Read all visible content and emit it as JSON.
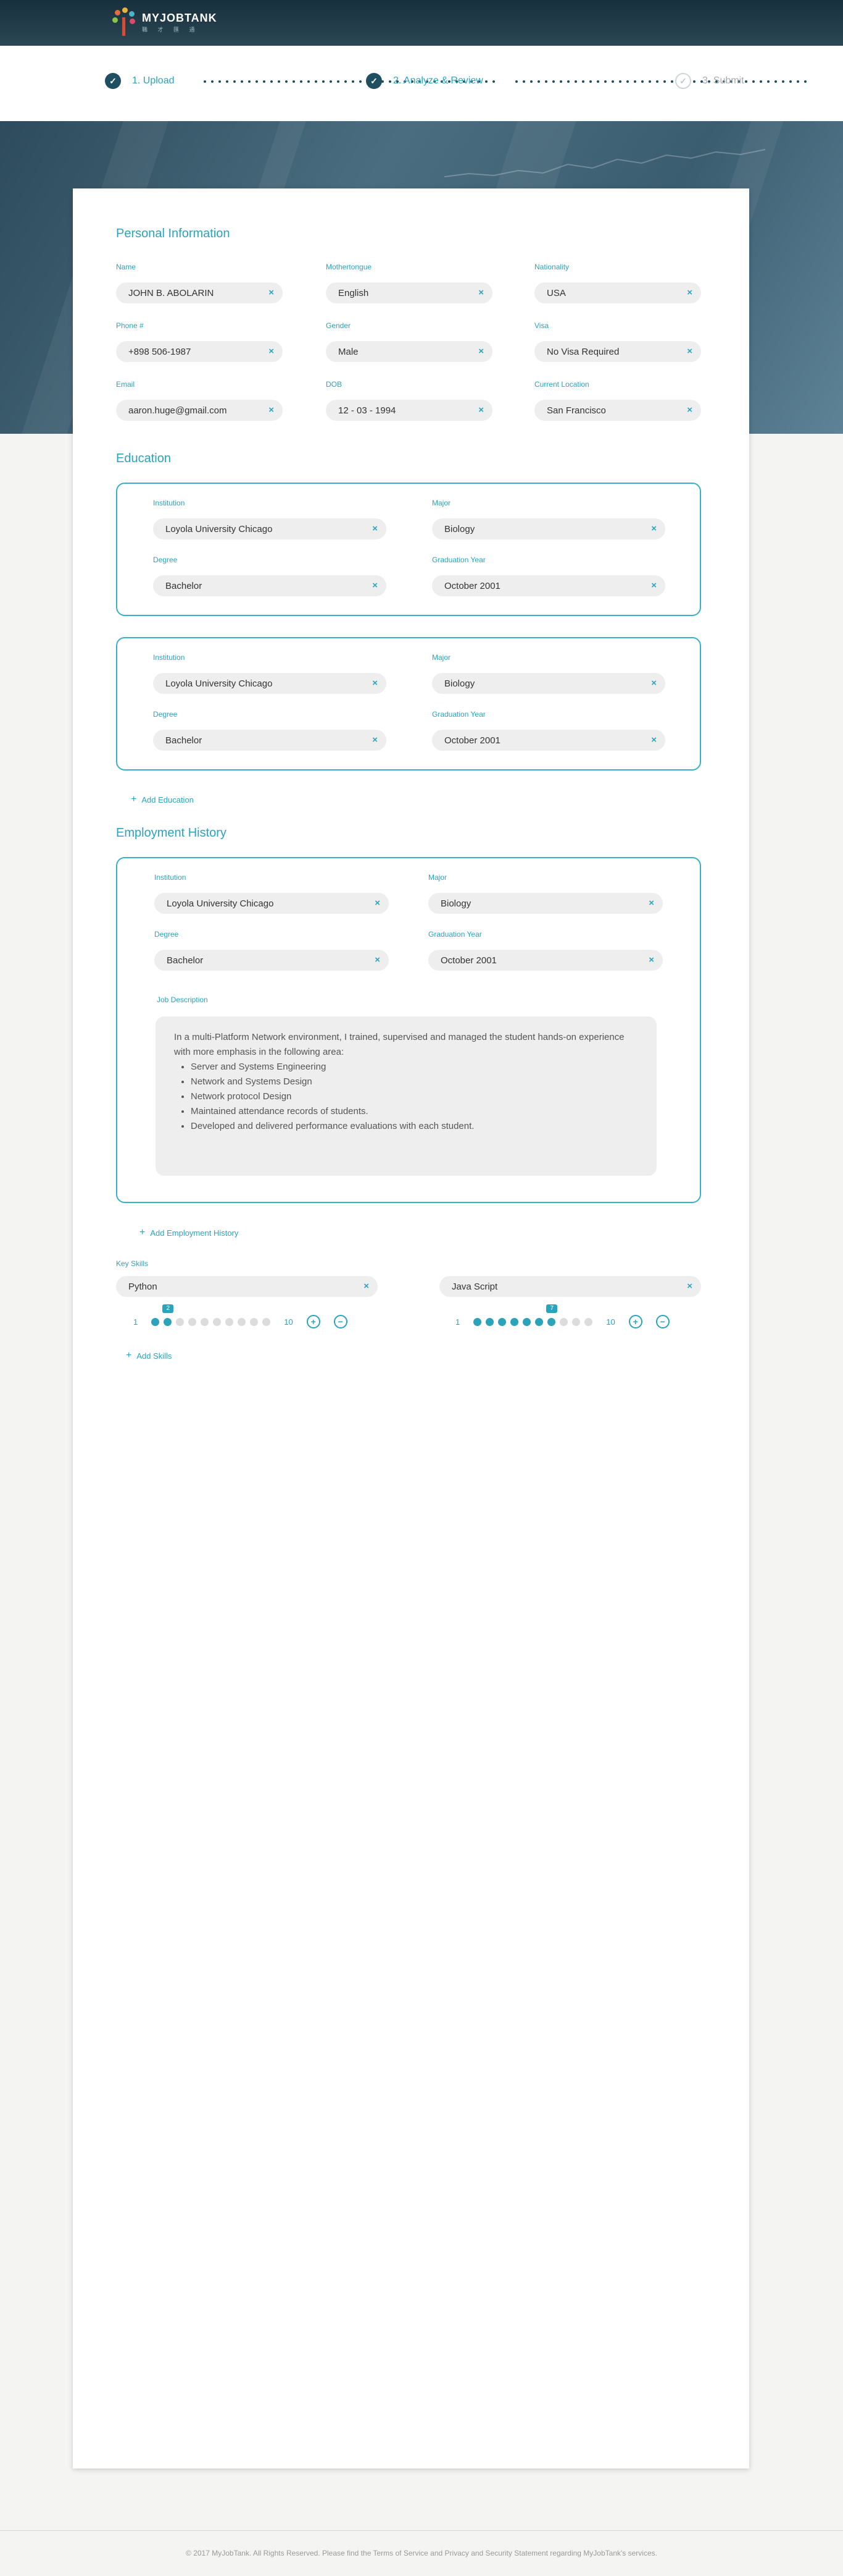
{
  "brand": {
    "name": "MYJOBTANK",
    "subtitle": "職 才 匯 通"
  },
  "steps": [
    {
      "label": "1. Upload",
      "state": "done",
      "mark": "✓"
    },
    {
      "label": "2. Analyze & Review",
      "state": "done",
      "mark": "✓"
    },
    {
      "label": "3. Submit",
      "state": "todo",
      "mark": "✓"
    }
  ],
  "personal": {
    "title": "Personal Information",
    "fields": [
      {
        "label": "Name",
        "value": "JOHN B. ABOLARIN"
      },
      {
        "label": "Mothertongue",
        "value": "English"
      },
      {
        "label": "Nationality",
        "value": "USA"
      },
      {
        "label": "Phone #",
        "value": "+898 506-1987"
      },
      {
        "label": "Gender",
        "value": "Male"
      },
      {
        "label": "Visa",
        "value": "No Visa Required"
      },
      {
        "label": "Email",
        "value": "aaron.huge@gmail.com"
      },
      {
        "label": "DOB",
        "value": "12 - 03 - 1994"
      },
      {
        "label": "Current Location",
        "value": "San Francisco"
      }
    ]
  },
  "education": {
    "title": "Education",
    "entries": [
      {
        "institution_label": "Institution",
        "institution": "Loyola University Chicago",
        "major_label": "Major",
        "major": "Biology",
        "degree_label": "Degree",
        "degree": "Bachelor",
        "grad_label": "Graduation Year",
        "grad": "October 2001"
      },
      {
        "institution_label": "Institution",
        "institution": "Loyola University Chicago",
        "major_label": "Major",
        "major": "Biology",
        "degree_label": "Degree",
        "degree": "Bachelor",
        "grad_label": "Graduation Year",
        "grad": "October 2001"
      }
    ],
    "add_label": "Add Education"
  },
  "employment": {
    "title": "Employment History",
    "entry": {
      "institution_label": "Institution",
      "institution": "Loyola University Chicago",
      "major_label": "Major",
      "major": "Biology",
      "degree_label": "Degree",
      "degree": "Bachelor",
      "grad_label": "Graduation Year",
      "grad": "October 2001",
      "desc_label": "Job Description",
      "desc_intro": "In a multi-Platform Network environment, I trained, supervised and managed the student hands-on experience with more emphasis in the following area:",
      "desc_items": [
        "Server and Systems Engineering",
        "Network and Systems Design",
        "Network protocol Design",
        "Maintained attendance records of students.",
        "Developed and delivered performance evaluations with each student."
      ]
    },
    "add_label": "Add Employment History"
  },
  "skills": {
    "title": "Key Skills",
    "items": [
      {
        "name": "Python",
        "level": 2,
        "min": "1",
        "max": "10"
      },
      {
        "name": "Java Script",
        "level": 7,
        "min": "1",
        "max": "10"
      }
    ],
    "add_label": "Add Skills"
  },
  "icons": {
    "remove": "×",
    "plus": "+",
    "minus": "−"
  },
  "colors": {
    "accent": "#2ba3bc",
    "dark": "#1f4f60",
    "header": "#17303e"
  },
  "footer": "© 2017 MyJobTank. All Rights Reserved. Please find the Terms of Service and Privacy and Security Statement regarding MyJobTank's services."
}
